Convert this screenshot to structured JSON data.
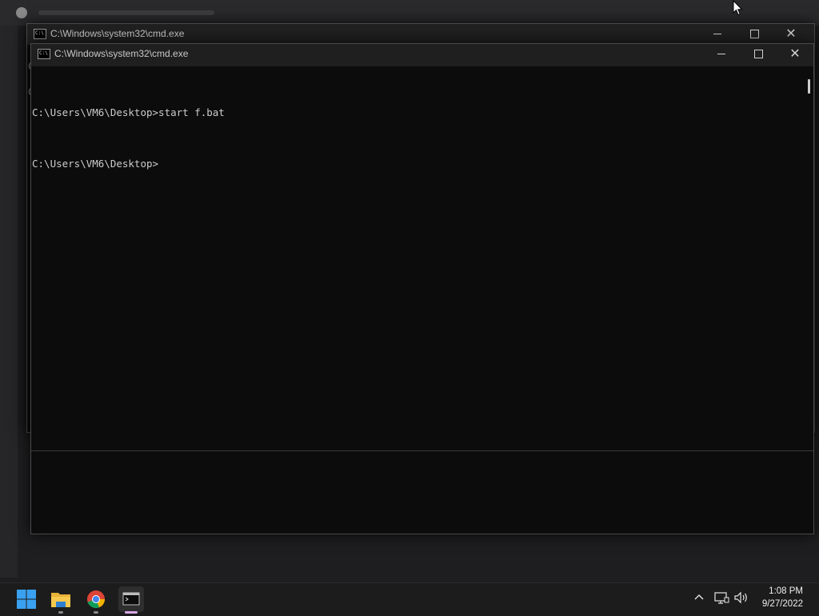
{
  "background_window": {
    "title": ""
  },
  "cmd_back": {
    "title": "C:\\Windows\\system32\\cmd.exe",
    "peek_lines": [
      "C",
      "C"
    ]
  },
  "cmd_front": {
    "title": "C:\\Windows\\system32\\cmd.exe",
    "lines": [
      "C:\\Users\\VM6\\Desktop>start f.bat",
      "C:\\Users\\VM6\\Desktop>"
    ]
  },
  "window_controls": {
    "minimize": "minimize-icon",
    "maximize": "maximize-icon",
    "close": "close-icon"
  },
  "taskbar": {
    "items": [
      {
        "name": "start",
        "icon": "windows-start-icon"
      },
      {
        "name": "file-explorer",
        "icon": "folder-icon"
      },
      {
        "name": "chrome",
        "icon": "chrome-icon"
      },
      {
        "name": "command-prompt",
        "icon": "cmd-icon"
      }
    ],
    "tray": {
      "chevron_icon": "chevron-up-icon",
      "network_icon": "network-icon",
      "volume_icon": "volume-icon"
    },
    "clock": {
      "time": "1:08 PM",
      "date": "9/27/2022"
    }
  },
  "colors": {
    "console_bg": "#0c0c0c",
    "console_text": "#cccccc",
    "titlebar": "#202020",
    "taskbar": "#1c1c1c",
    "accent_indicator": "#d7a7e5"
  }
}
